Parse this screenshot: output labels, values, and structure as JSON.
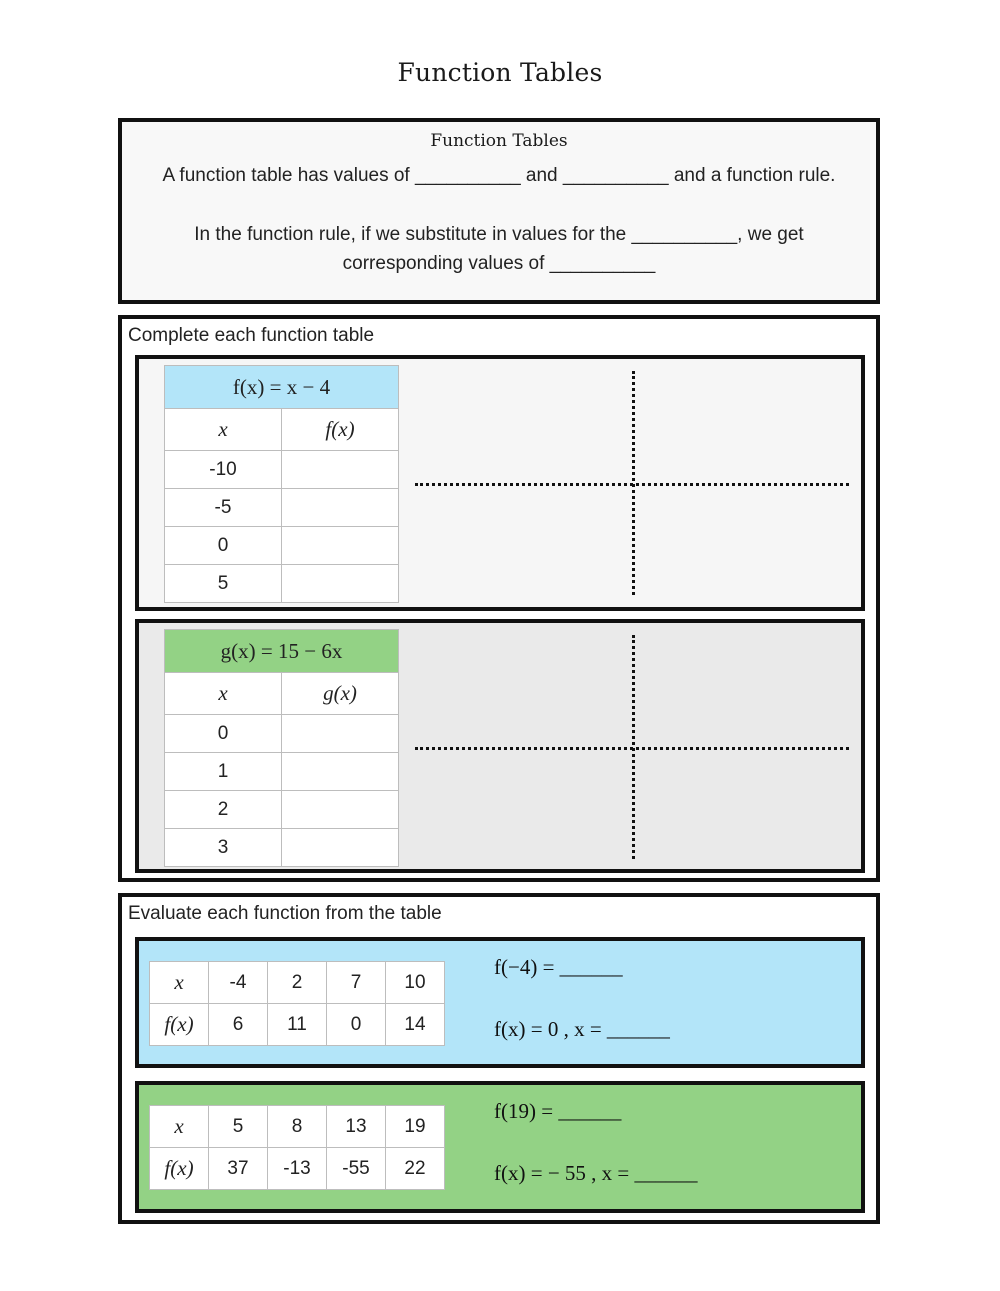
{
  "page": {
    "title": "Function Tables"
  },
  "intro": {
    "heading": "Function Tables",
    "line1": "A function table has values of __________ and __________ and a function rule.",
    "line2": "In the function rule, if we substitute in values for the __________, we get",
    "line3": "corresponding values of __________"
  },
  "complete": {
    "label": "Complete each function table",
    "tables": [
      {
        "rule": "f(x) = x − 4",
        "col_x": "x",
        "col_y": "f(x)",
        "color": "#b3e5f9",
        "rows": [
          {
            "x": "-10",
            "y": ""
          },
          {
            "x": "-5",
            "y": ""
          },
          {
            "x": "0",
            "y": ""
          },
          {
            "x": "5",
            "y": ""
          }
        ]
      },
      {
        "rule": "g(x) = 15 − 6x",
        "col_x": "x",
        "col_y": "g(x)",
        "color": "#93d285",
        "rows": [
          {
            "x": "0",
            "y": ""
          },
          {
            "x": "1",
            "y": ""
          },
          {
            "x": "2",
            "y": ""
          },
          {
            "x": "3",
            "y": ""
          }
        ]
      }
    ]
  },
  "evaluate": {
    "label": "Evaluate each function from the table",
    "panels": [
      {
        "color": "#b3e5f9",
        "row_x_label": "x",
        "row_y_label": "f(x)",
        "x": [
          "-4",
          "2",
          "7",
          "10"
        ],
        "y": [
          "6",
          "11",
          "0",
          "14"
        ],
        "question1": "f(−4) = ______",
        "question2": "f(x) = 0 , x = ______"
      },
      {
        "color": "#93d285",
        "row_x_label": "x",
        "row_y_label": "f(x)",
        "x": [
          "5",
          "8",
          "13",
          "19"
        ],
        "y": [
          "37",
          "-13",
          "-55",
          "22"
        ],
        "question1": "f(19) = ______",
        "question2": "f(x) = − 55 , x = ______"
      }
    ]
  }
}
